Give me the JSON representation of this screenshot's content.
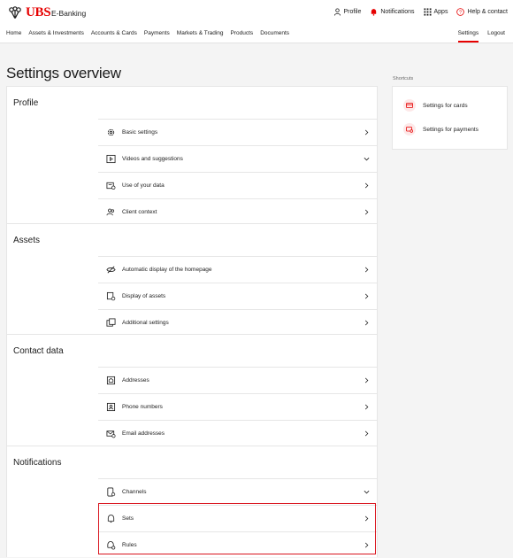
{
  "brand": {
    "logo_text": "UBS",
    "product": "E-Banking",
    "accent": "#e60000"
  },
  "utility_nav": [
    {
      "label": "Profile",
      "icon": "person-icon"
    },
    {
      "label": "Notifications",
      "icon": "bell-icon"
    },
    {
      "label": "Apps",
      "icon": "grid-icon"
    },
    {
      "label": "Help & contact",
      "icon": "help-icon"
    }
  ],
  "main_nav": [
    "Home",
    "Assets & Investments",
    "Accounts & Cards",
    "Payments",
    "Markets & Trading",
    "Products",
    "Documents"
  ],
  "right_nav": {
    "settings": "Settings",
    "logout": "Logout"
  },
  "page": {
    "title": "Settings overview"
  },
  "sections": [
    {
      "title": "Profile",
      "items": [
        {
          "label": "Basic settings",
          "icon": "gear-person-icon",
          "chevron": "right"
        },
        {
          "label": "Videos and suggestions",
          "icon": "video-icon",
          "chevron": "down"
        },
        {
          "label": "Use of your data",
          "icon": "data-icon",
          "chevron": "right"
        },
        {
          "label": "Client context",
          "icon": "people-icon",
          "chevron": "right"
        }
      ]
    },
    {
      "title": "Assets",
      "items": [
        {
          "label": "Automatic display of the homepage",
          "icon": "eye-off-icon",
          "chevron": "right"
        },
        {
          "label": "Display of assets",
          "icon": "assets-gear-icon",
          "chevron": "right"
        },
        {
          "label": "Additional settings",
          "icon": "coins-icon",
          "chevron": "right"
        }
      ]
    },
    {
      "title": "Contact data",
      "items": [
        {
          "label": "Addresses",
          "icon": "house-icon",
          "chevron": "right"
        },
        {
          "label": "Phone numbers",
          "icon": "phone-contact-icon",
          "chevron": "right"
        },
        {
          "label": "Email addresses",
          "icon": "email-gear-icon",
          "chevron": "right"
        }
      ]
    },
    {
      "title": "Notifications",
      "items": [
        {
          "label": "Channels",
          "icon": "device-icon",
          "chevron": "down"
        },
        {
          "label": "Sets",
          "icon": "bell-outline-icon",
          "chevron": "right"
        },
        {
          "label": "Rules",
          "icon": "bell-gear-icon",
          "chevron": "right"
        }
      ]
    }
  ],
  "shortcuts": {
    "label": "Shortcuts",
    "items": [
      {
        "label": "Settings for cards",
        "icon": "card-gear-icon"
      },
      {
        "label": "Settings for payments",
        "icon": "payment-gear-icon"
      }
    ]
  }
}
